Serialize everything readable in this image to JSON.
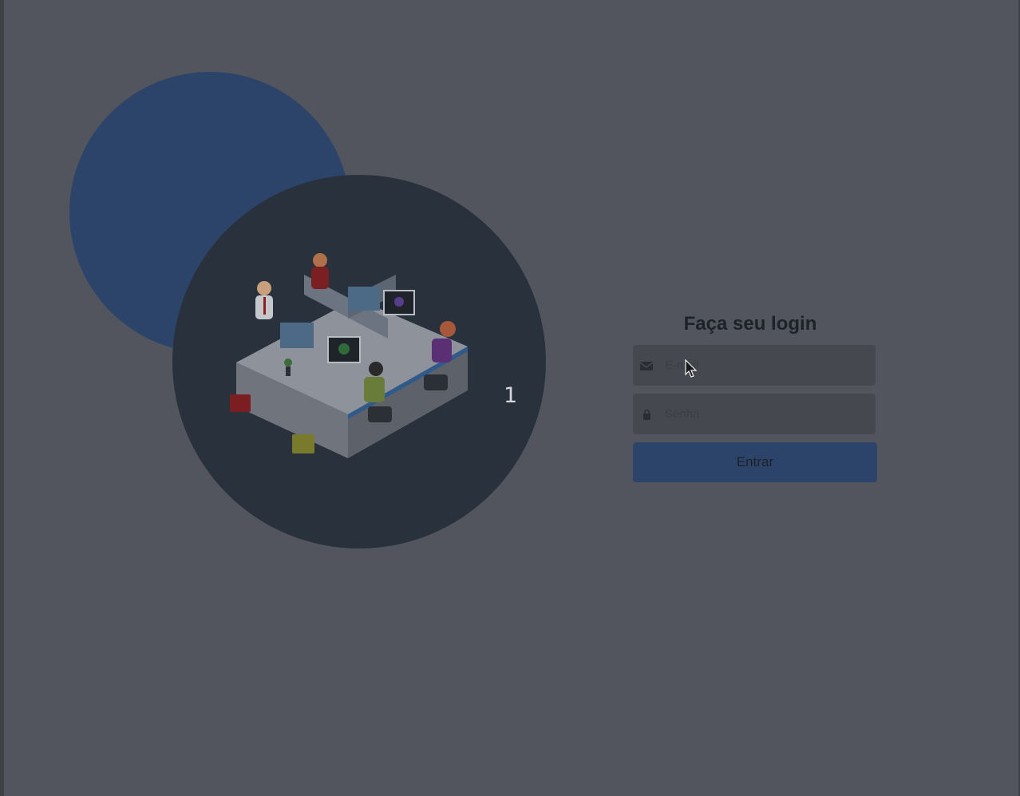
{
  "carousel": {
    "slide_number": "1"
  },
  "login": {
    "title": "Faça seu login",
    "email_placeholder": "E-mail",
    "password_placeholder": "Senha",
    "submit_label": "Entrar"
  },
  "icons": {
    "email": "envelope-icon",
    "password": "lock-icon"
  },
  "colors": {
    "background": "#52555d",
    "accent_blue": "#2c4469",
    "illustration_bg": "#28313c",
    "input_bg": "#45484f"
  }
}
